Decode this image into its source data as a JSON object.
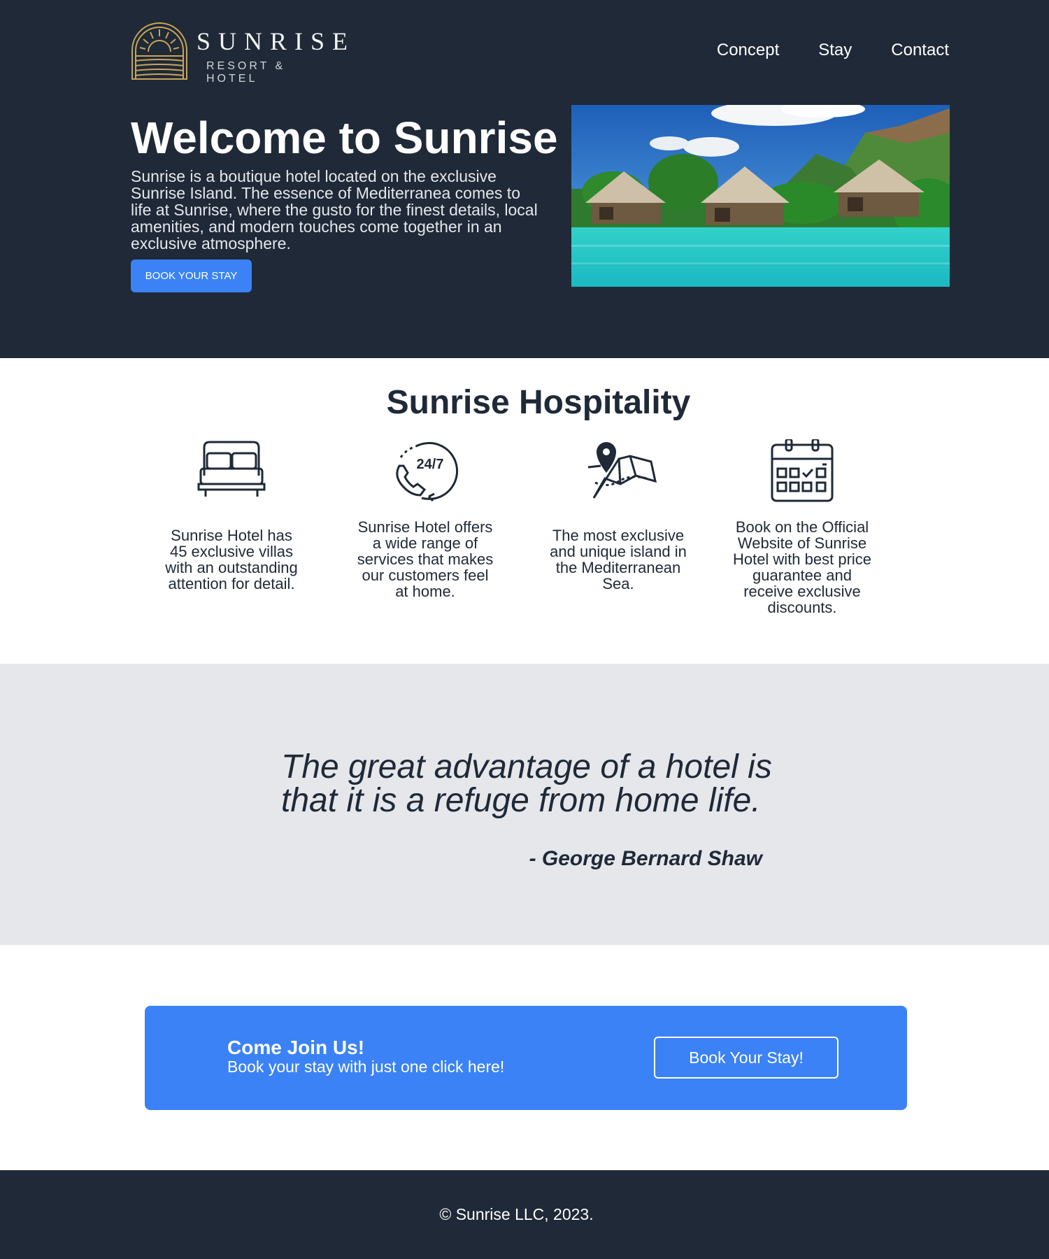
{
  "brand": {
    "name": "SUNRISE",
    "tagline": "RESORT & HOTEL",
    "logo_color": "#c8a45a"
  },
  "nav": {
    "items": [
      "Concept",
      "Stay",
      "Contact"
    ]
  },
  "hero": {
    "title": "Welcome to Sunrise",
    "description": "Sunrise is a boutique hotel located on the exclusive Sunrise Island. The essence of Mediterranea comes to life at Sunrise, where the gusto for the finest details, local amenities, and modern touches come together in an exclusive atmosphere.",
    "cta_label": "BOOK YOUR STAY"
  },
  "features": {
    "title": "Sunrise Hospitality",
    "items": [
      {
        "icon": "bed-icon",
        "text": "Sunrise Hotel has 45 exclusive villas with an outstanding attention for detail."
      },
      {
        "icon": "phone-24-7-icon",
        "badge": "24/7",
        "text": "Sunrise Hotel offers a wide range of services that makes our customers feel at home."
      },
      {
        "icon": "map-pin-icon",
        "text": "The most exclusive and unique island in the Mediterranean Sea."
      },
      {
        "icon": "calendar-icon",
        "text": "Book on the Official Website of Sunrise Hotel with best price guarantee and receive exclusive discounts."
      }
    ]
  },
  "quote": {
    "text": "The great advantage of a hotel is that it is a refuge from home life.",
    "author": "- George Bernard Shaw"
  },
  "cta": {
    "title": "Come Join Us!",
    "subtitle": "Book your stay with just one click here!",
    "button_label": "Book Your Stay!"
  },
  "footer": {
    "text": "© Sunrise LLC, 2023."
  },
  "colors": {
    "dark": "#1f2937",
    "accent": "#3b82f6",
    "light_gray": "#e5e7eb"
  }
}
